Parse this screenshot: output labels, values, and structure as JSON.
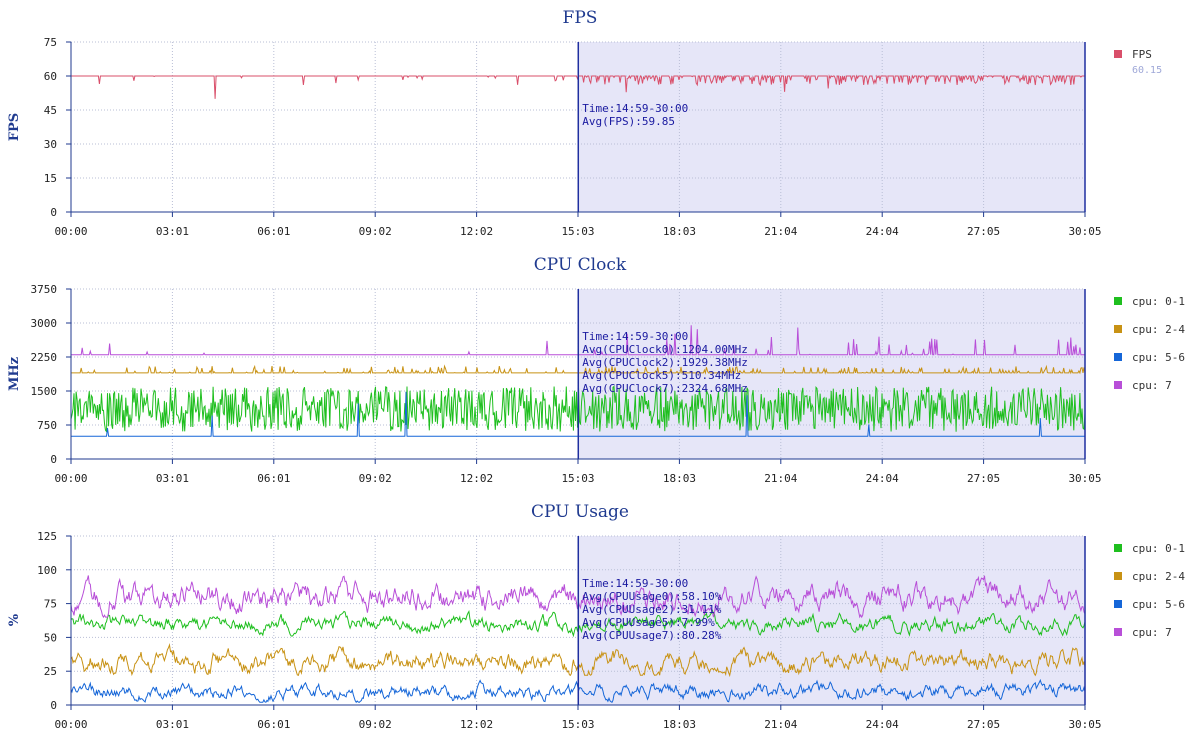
{
  "colors": {
    "axis": "#1f3a8f",
    "grid": "#b9bfd6",
    "selection_fill": "#e6e6f8",
    "selection_line": "#1f2fa0",
    "annotation": "#1a1aa0"
  },
  "selection": {
    "start": "15:03",
    "end": "30:05"
  },
  "chart_data": [
    {
      "type": "line",
      "title": "FPS",
      "ylabel": "FPS",
      "xlabel": "",
      "ylim": [
        0,
        75
      ],
      "yticks": [
        "0",
        "15",
        "30",
        "45",
        "60",
        "75"
      ],
      "x_ticks": [
        "00:00",
        "03:01",
        "06:01",
        "09:02",
        "12:02",
        "15:03",
        "18:03",
        "21:04",
        "24:04",
        "27:05",
        "30:05"
      ],
      "grid": true,
      "legend_position": "right",
      "series": [
        {
          "name": "FPS",
          "color": "#d94f6a",
          "baseline": 60,
          "range": [
            56,
            60
          ],
          "min_dip": 49,
          "legend_sub": "60.15"
        }
      ],
      "annotation": [
        "Time:14:59-30:00",
        "Avg(FPS):59.85"
      ]
    },
    {
      "type": "line",
      "title": "CPU Clock",
      "ylabel": "MHz",
      "xlabel": "",
      "ylim": [
        0,
        3750
      ],
      "yticks": [
        "0",
        "750",
        "1500",
        "2250",
        "3000",
        "3750"
      ],
      "x_ticks": [
        "00:00",
        "03:01",
        "06:01",
        "09:02",
        "12:02",
        "15:03",
        "18:03",
        "21:04",
        "24:04",
        "27:05",
        "30:05"
      ],
      "grid": true,
      "legend_position": "right",
      "series": [
        {
          "name": "cpu: 0-1",
          "color": "#1fbf1f",
          "range": [
            600,
            1600
          ]
        },
        {
          "name": "cpu: 2-4",
          "color": "#c89214",
          "baseline": 1900,
          "range": [
            1900,
            2050
          ]
        },
        {
          "name": "cpu: 5-6",
          "color": "#1566d8",
          "baseline": 500,
          "range": [
            500,
            1500
          ]
        },
        {
          "name": "cpu: 7",
          "color": "#b84fd8",
          "baseline": 2300,
          "range": [
            2300,
            3000
          ]
        }
      ],
      "annotation": [
        "Time:14:59-30:00",
        "Avg(CPUClock0):1204.00MHz",
        "Avg(CPUClock2):1929.38MHz",
        "Avg(CPUClock5):510.34MHz",
        "Avg(CPUClock7):2324.68MHz"
      ]
    },
    {
      "type": "line",
      "title": "CPU Usage",
      "ylabel": "%",
      "xlabel": "",
      "ylim": [
        0,
        125
      ],
      "yticks": [
        "0",
        "25",
        "50",
        "75",
        "100",
        "125"
      ],
      "x_ticks": [
        "00:00",
        "03:01",
        "06:01",
        "09:02",
        "12:02",
        "15:03",
        "18:03",
        "21:04",
        "24:04",
        "27:05",
        "30:05"
      ],
      "grid": true,
      "legend_position": "right",
      "series": [
        {
          "name": "cpu: 0-1",
          "color": "#1fbf1f",
          "mean": 60,
          "range": [
            50,
            70
          ]
        },
        {
          "name": "cpu: 2-4",
          "color": "#c89214",
          "mean": 32,
          "range": [
            22,
            48
          ]
        },
        {
          "name": "cpu: 5-6",
          "color": "#1566d8",
          "mean": 10,
          "range": [
            2,
            20
          ]
        },
        {
          "name": "cpu: 7",
          "color": "#b84fd8",
          "mean": 80,
          "range": [
            65,
            98
          ]
        }
      ],
      "annotation": [
        "Time:14:59-30:00",
        "Avg(CPUUsage0):58.10%",
        "Avg(CPUUsage2):31.11%",
        "Avg(CPUUsage5):7.99%",
        "Avg(CPUUsage7):80.28%"
      ]
    }
  ]
}
